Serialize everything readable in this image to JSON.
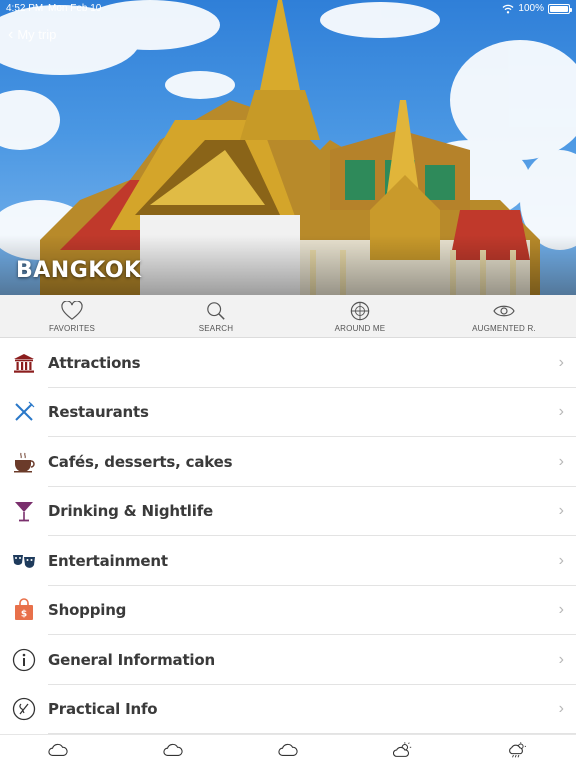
{
  "status_bar": {
    "time": "4:52 PM",
    "date": "Mon Feb 10",
    "battery": "100%"
  },
  "header": {
    "back_label": "My trip",
    "city": "BANGKOK"
  },
  "toolbar": [
    {
      "label": "FAVORITES",
      "icon": "heart-icon"
    },
    {
      "label": "SEARCH",
      "icon": "search-icon"
    },
    {
      "label": "AROUND ME",
      "icon": "compass-icon"
    },
    {
      "label": "AUGMENTED R.",
      "icon": "eye-icon"
    }
  ],
  "menu": [
    {
      "label": "Attractions",
      "icon": "museum-icon",
      "color": "#8b1d1d"
    },
    {
      "label": "Restaurants",
      "icon": "fork-knife-icon",
      "color": "#2a78c8"
    },
    {
      "label": "Cafés, desserts, cakes",
      "icon": "coffee-cup-icon",
      "color": "#6b3b2a"
    },
    {
      "label": "Drinking & Nightlife",
      "icon": "cocktail-icon",
      "color": "#7a2f6d"
    },
    {
      "label": "Entertainment",
      "icon": "theater-masks-icon",
      "color": "#1f3b5c"
    },
    {
      "label": "Shopping",
      "icon": "shopping-bag-icon",
      "color": "#e8704a"
    },
    {
      "label": "General Information",
      "icon": "info-icon",
      "color": "#333333"
    },
    {
      "label": "Practical Info",
      "icon": "tools-icon",
      "color": "#333333"
    }
  ],
  "weather": [
    {
      "icon": "cloud-icon",
      "temp": ""
    },
    {
      "icon": "cloud-icon",
      "temp": ""
    },
    {
      "icon": "cloud-icon",
      "temp": ""
    },
    {
      "icon": "sun-cloud-icon",
      "temp": ""
    },
    {
      "icon": "rain-cloud-icon",
      "temp": ""
    }
  ]
}
